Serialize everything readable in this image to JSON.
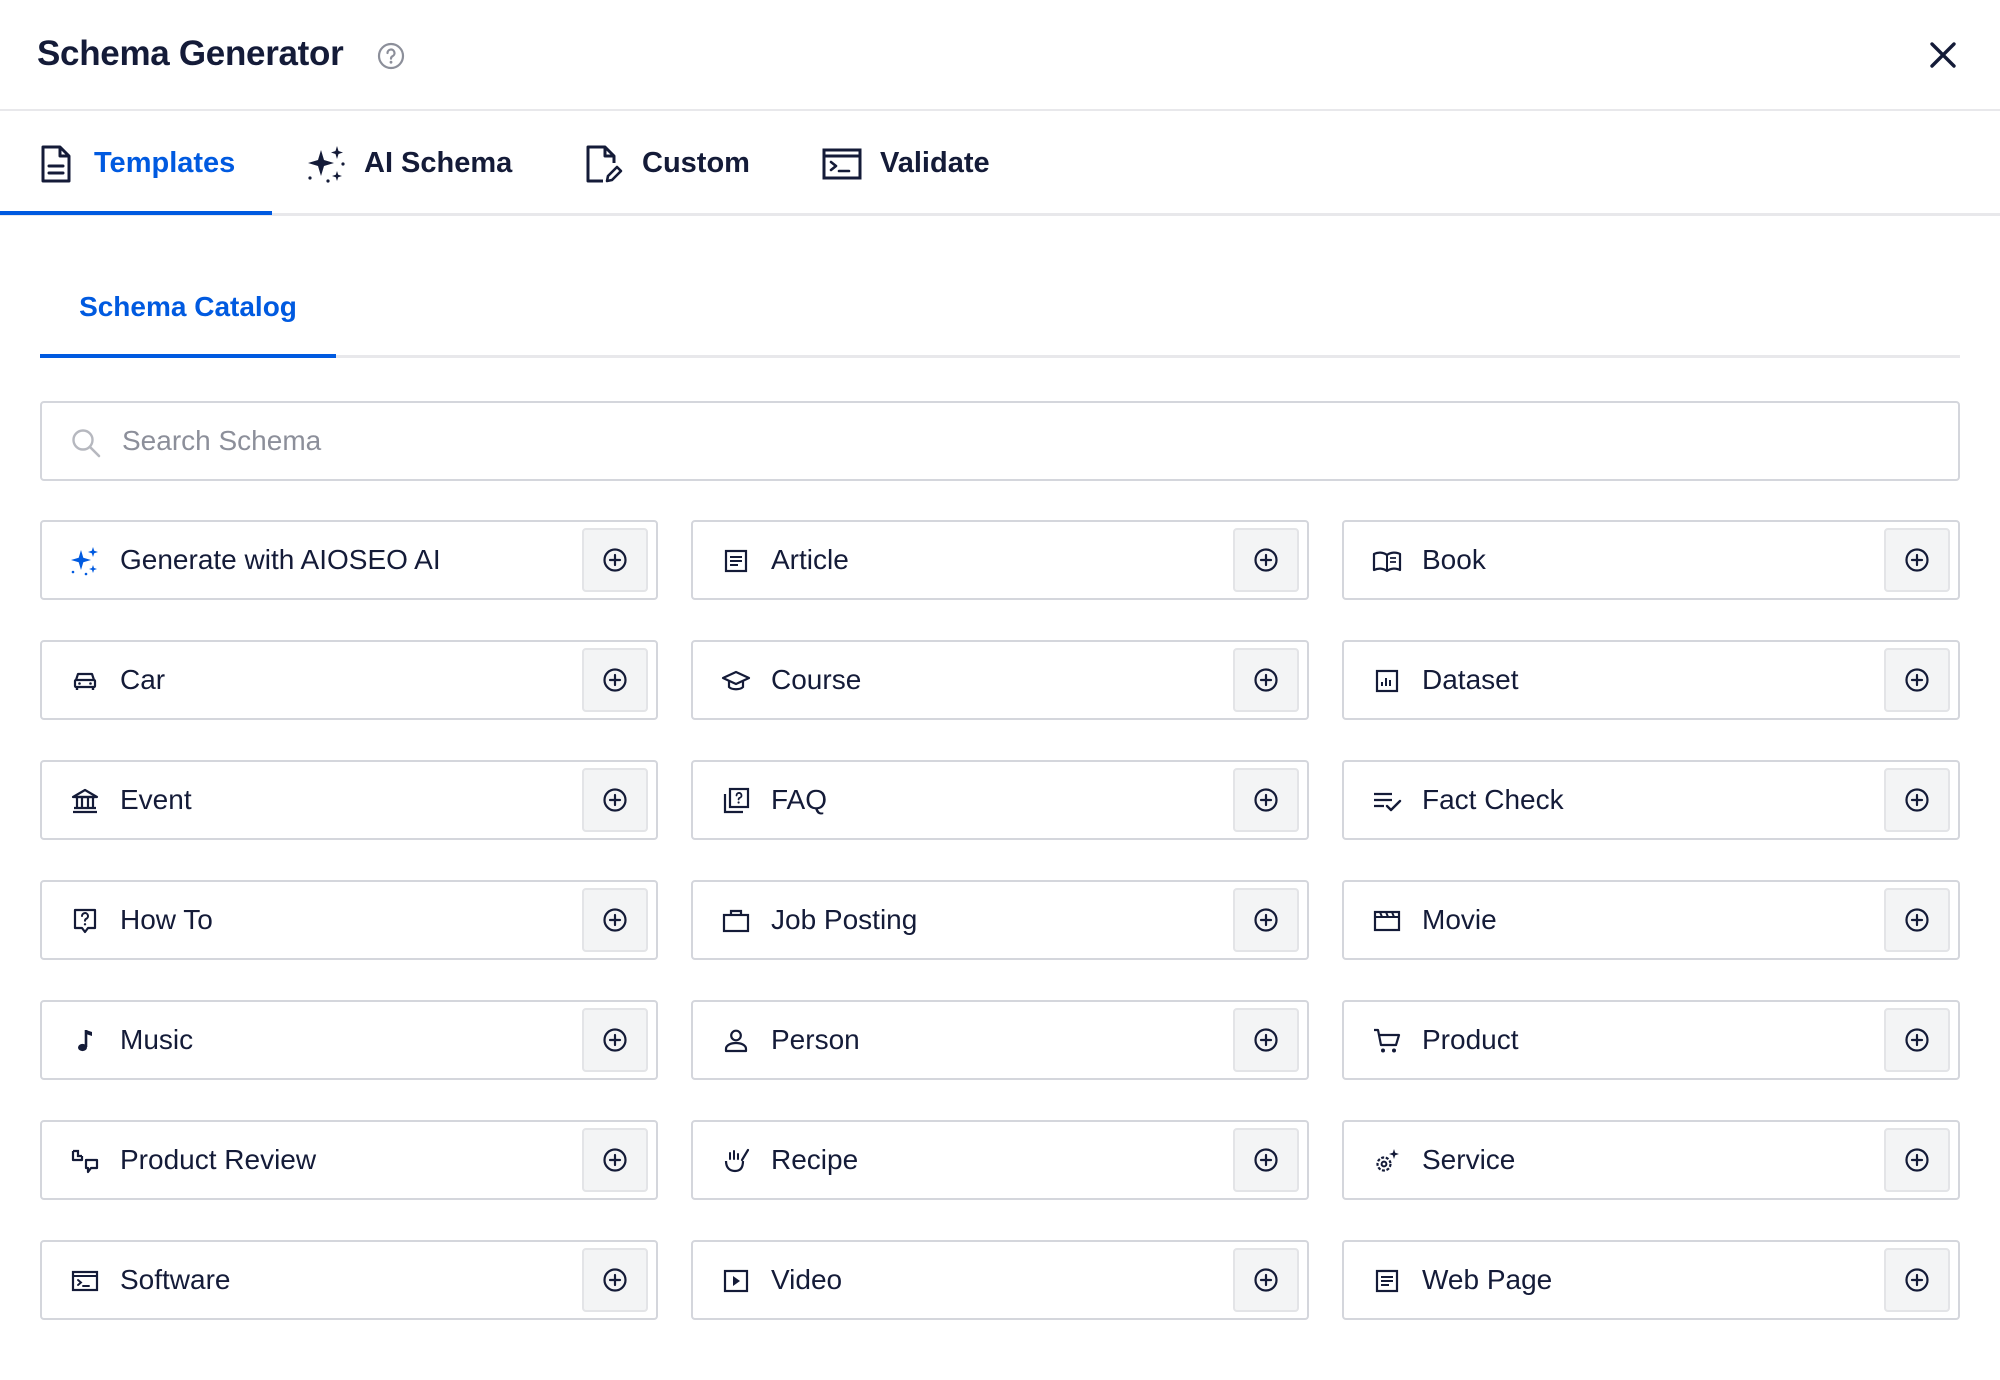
{
  "header": {
    "title": "Schema Generator",
    "help_icon": "help-circle-icon",
    "close_icon": "close-icon"
  },
  "tabs": [
    {
      "label": "Templates",
      "icon": "document-icon",
      "active": true
    },
    {
      "label": "AI Schema",
      "icon": "sparkles-icon",
      "active": false
    },
    {
      "label": "Custom",
      "icon": "edit-document-icon",
      "active": false
    },
    {
      "label": "Validate",
      "icon": "terminal-icon",
      "active": false
    }
  ],
  "subtabs": [
    {
      "label": "Schema Catalog",
      "active": true
    }
  ],
  "search": {
    "placeholder": "Search Schema",
    "value": ""
  },
  "colors": {
    "accent": "#005ae0",
    "text": "#141b38",
    "border": "#d4d6dc"
  },
  "schemas": [
    {
      "label": "Generate with AIOSEO AI",
      "icon": "sparkles-icon"
    },
    {
      "label": "Article",
      "icon": "article-icon"
    },
    {
      "label": "Book",
      "icon": "book-icon"
    },
    {
      "label": "Car",
      "icon": "car-icon"
    },
    {
      "label": "Course",
      "icon": "graduation-cap-icon"
    },
    {
      "label": "Dataset",
      "icon": "dataset-icon"
    },
    {
      "label": "Event",
      "icon": "event-building-icon"
    },
    {
      "label": "FAQ",
      "icon": "faq-icon"
    },
    {
      "label": "Fact Check",
      "icon": "fact-check-icon"
    },
    {
      "label": "How To",
      "icon": "how-to-icon"
    },
    {
      "label": "Job Posting",
      "icon": "briefcase-icon"
    },
    {
      "label": "Movie",
      "icon": "movie-icon"
    },
    {
      "label": "Music",
      "icon": "music-note-icon"
    },
    {
      "label": "Person",
      "icon": "person-icon"
    },
    {
      "label": "Product",
      "icon": "cart-icon"
    },
    {
      "label": "Product Review",
      "icon": "review-icon"
    },
    {
      "label": "Recipe",
      "icon": "recipe-icon"
    },
    {
      "label": "Service",
      "icon": "service-gear-icon"
    },
    {
      "label": "Software",
      "icon": "software-icon"
    },
    {
      "label": "Video",
      "icon": "video-icon"
    },
    {
      "label": "Web Page",
      "icon": "web-page-icon"
    }
  ]
}
